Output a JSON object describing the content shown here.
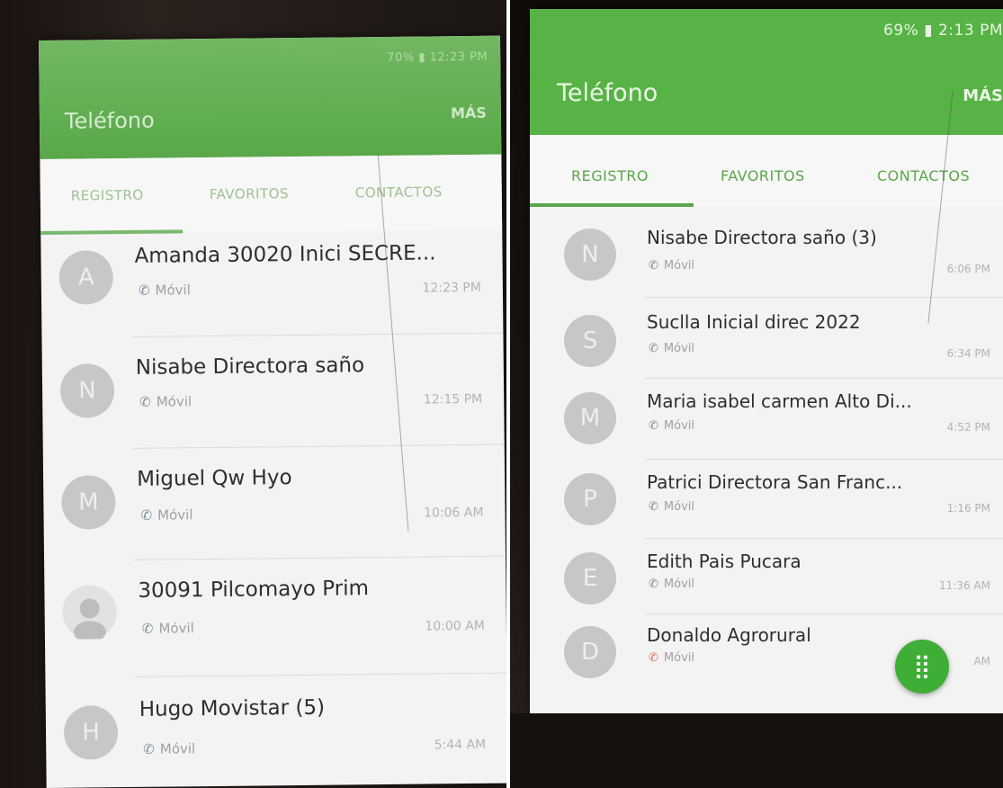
{
  "left_screen": {
    "status": "70% ▮ 12:23 PM",
    "title": "Teléfono",
    "more": "MÁS",
    "tabs": [
      "REGISTRO",
      "FAVORITOS",
      "CONTACTOS"
    ],
    "entries": [
      {
        "initial": "A",
        "name": "Amanda 30020 Inici SECRE...",
        "type": "Móvil",
        "time": "12:23 PM"
      },
      {
        "initial": "N",
        "name": "Nisabe Directora saño",
        "type": "Móvil",
        "time": "12:15 PM"
      },
      {
        "initial": "M",
        "name": "Miguel Qw Hyo",
        "type": "Móvil",
        "time": "10:06 AM"
      },
      {
        "initial": "",
        "name": "30091 Pilcomayo Prim",
        "type": "Móvil",
        "time": "10:00 AM"
      },
      {
        "initial": "H",
        "name": "Hugo Movistar (5)",
        "type": "Móvil",
        "time": "5:44 AM"
      }
    ]
  },
  "right_screen": {
    "status": "69% ▮ 2:13 PM",
    "title": "Teléfono",
    "more": "MÁS",
    "tabs": [
      "REGISTRO",
      "FAVORITOS",
      "CONTACTOS"
    ],
    "entries": [
      {
        "initial": "N",
        "name": "Nisabe Directora saño (3)",
        "type": "Móvil",
        "time": "6:06 PM"
      },
      {
        "initial": "S",
        "name": "Suclla Inicial direc 2022",
        "type": "Móvil",
        "time": "6:34 PM"
      },
      {
        "initial": "M",
        "name": "Maria isabel carmen Alto Di...",
        "type": "Móvil",
        "time": "4:52 PM"
      },
      {
        "initial": "P",
        "name": "Patrici Directora San Franc...",
        "type": "Móvil",
        "time": "1:16 PM"
      },
      {
        "initial": "E",
        "name": "Edith Pais Pucara",
        "type": "Móvil",
        "time": "11:36 AM"
      },
      {
        "initial": "D",
        "name": "Donaldo Agrorural",
        "type": "Móvil",
        "time": "AM"
      }
    ]
  },
  "colors": {
    "appbar_green": "#57b345",
    "tab_green": "#5aa64a",
    "fab_green": "#3fae36",
    "missed_red": "#e06a5a"
  },
  "icons": {
    "call": "incoming-call-icon",
    "missed": "missed-call-icon",
    "fab": "dialpad-icon",
    "contact_photo": "contact-photo-icon"
  }
}
